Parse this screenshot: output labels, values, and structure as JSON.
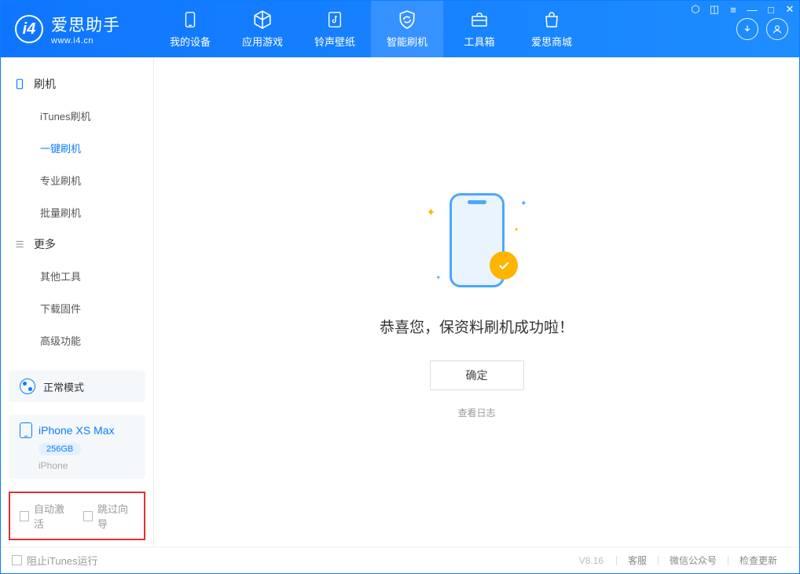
{
  "app": {
    "name_cn": "爱思助手",
    "name_en": "www.i4.cn"
  },
  "topnav": {
    "items": [
      {
        "label": "我的设备"
      },
      {
        "label": "应用游戏"
      },
      {
        "label": "铃声壁纸"
      },
      {
        "label": "智能刷机"
      },
      {
        "label": "工具箱"
      },
      {
        "label": "爱思商城"
      }
    ],
    "active_index": 3
  },
  "sidebar": {
    "groups": [
      {
        "title": "刷机",
        "items": [
          "iTunes刷机",
          "一键刷机",
          "专业刷机",
          "批量刷机"
        ],
        "active_index": 1
      },
      {
        "title": "更多",
        "items": [
          "其他工具",
          "下载固件",
          "高级功能"
        ]
      }
    ],
    "mode_label": "正常模式",
    "device": {
      "name": "iPhone XS Max",
      "capacity": "256GB",
      "subtype": "iPhone"
    },
    "checkboxes": {
      "auto_activate": "自动激活",
      "skip_guide": "跳过向导"
    }
  },
  "main": {
    "success_text": "恭喜您，保资料刷机成功啦！",
    "ok_button": "确定",
    "view_log": "查看日志"
  },
  "statusbar": {
    "block_itunes": "阻止iTunes运行",
    "version": "V8.16",
    "links": [
      "客服",
      "微信公众号",
      "检查更新"
    ]
  }
}
